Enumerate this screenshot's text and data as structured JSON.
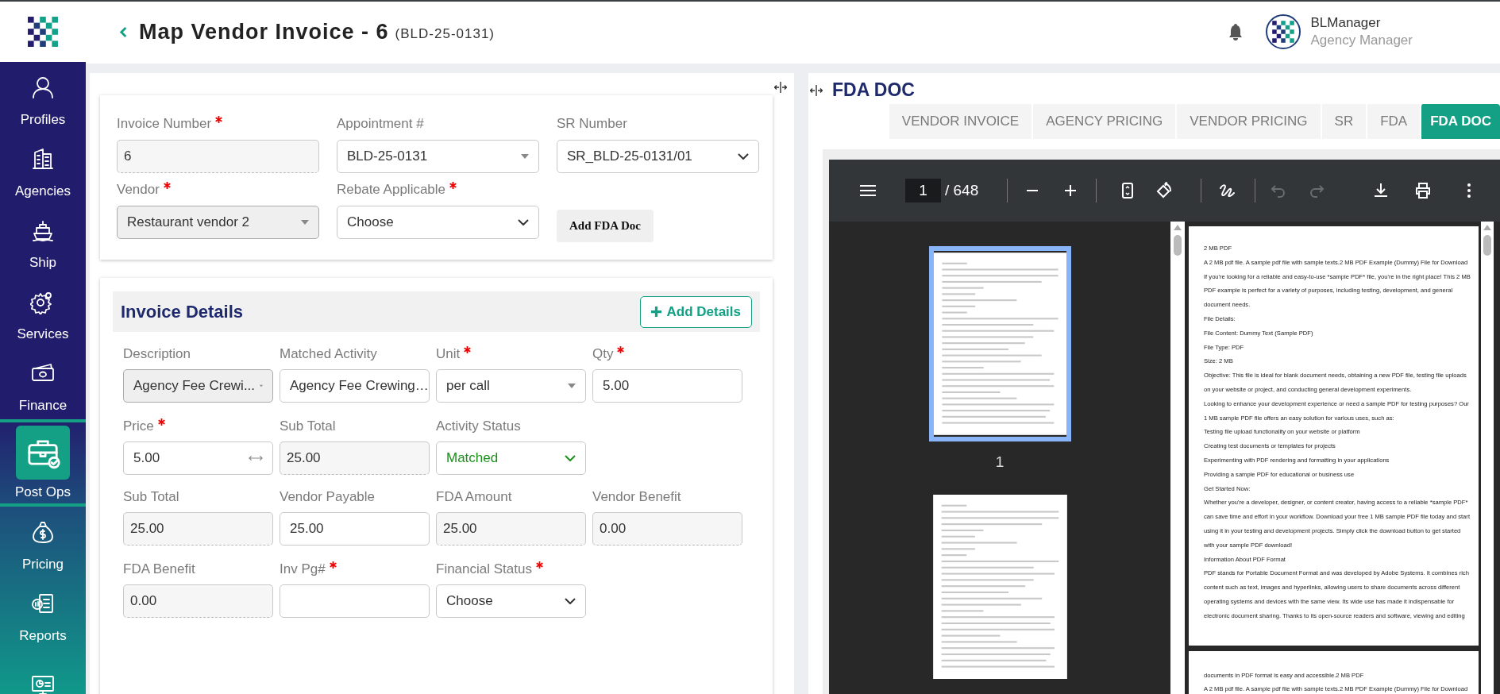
{
  "header": {
    "title": "Map Vendor Invoice - 6",
    "subtitle": "(BLD-25-0131)",
    "user": {
      "name": "BLManager",
      "role": "Agency Manager"
    }
  },
  "sidebar": {
    "items": [
      {
        "label": "Profiles",
        "selected": false
      },
      {
        "label": "Agencies",
        "selected": false
      },
      {
        "label": "Ship",
        "selected": false
      },
      {
        "label": "Services",
        "selected": false
      },
      {
        "label": "Finance",
        "selected": false
      },
      {
        "label": "Post Ops",
        "selected": true
      },
      {
        "label": "Pricing",
        "selected": false
      },
      {
        "label": "Reports",
        "selected": false
      }
    ]
  },
  "invoice_form": {
    "fields": [
      {
        "label": "Invoice Number",
        "required": true,
        "kind": "readonly",
        "value": "6"
      },
      {
        "label": "Appointment #",
        "required": false,
        "kind": "select",
        "value": "BLD-25-0131"
      },
      {
        "label": "SR Number",
        "required": false,
        "kind": "dropdown",
        "value": "SR_BLD-25-0131/01"
      },
      {
        "label": "Vendor",
        "required": true,
        "kind": "select-disabled",
        "value": "Restaurant vendor 2"
      },
      {
        "label": "Rebate Applicable",
        "required": true,
        "kind": "dropdown",
        "value": "Choose"
      }
    ],
    "add_fda_doc_button": "Add FDA Doc"
  },
  "invoice_details": {
    "title": "Invoice Details",
    "add_button": "Add Details",
    "sections": [
      {
        "fields": [
          {
            "label": "Description",
            "required": false,
            "kind": "select-disabled",
            "value": "Agency Fee Crewi..."
          },
          {
            "label": "Matched Activity",
            "required": false,
            "kind": "select",
            "value": "Agency Fee Crewing…"
          },
          {
            "label": "Unit",
            "required": true,
            "kind": "select",
            "value": "per call"
          },
          {
            "label": "Qty",
            "required": true,
            "kind": "input",
            "value": "5.00"
          },
          {
            "label": "Price",
            "required": true,
            "kind": "input",
            "resize_handle": true,
            "value": "5.00"
          },
          {
            "label": "Sub Total",
            "required": false,
            "kind": "readonly",
            "value": "25.00"
          },
          {
            "label": "Activity Status",
            "required": false,
            "kind": "status",
            "value": "Matched"
          }
        ]
      },
      {
        "fields": [
          {
            "label": "Sub Total",
            "required": false,
            "kind": "readonly",
            "value": "25.00"
          },
          {
            "label": "Vendor Payable",
            "required": false,
            "kind": "input",
            "value": "25.00"
          },
          {
            "label": "FDA Amount",
            "required": false,
            "kind": "readonly",
            "value": "25.00"
          },
          {
            "label": "Vendor Benefit",
            "required": false,
            "kind": "readonly",
            "value": "0.00"
          },
          {
            "label": "FDA Benefit",
            "required": false,
            "kind": "readonly",
            "value": "0.00"
          },
          {
            "label": "Inv Pg#",
            "required": true,
            "kind": "input"
          },
          {
            "label": "Financial Status",
            "required": true,
            "kind": "dropdown",
            "value": "Choose"
          }
        ]
      }
    ]
  },
  "doc_panel": {
    "title": "FDA DOC",
    "tabs": [
      {
        "label": "VENDOR INVOICE",
        "selected": false
      },
      {
        "label": "AGENCY PRICING",
        "selected": false
      },
      {
        "label": "VENDOR PRICING",
        "selected": false
      },
      {
        "label": "SR",
        "selected": false
      },
      {
        "label": "FDA",
        "selected": false
      },
      {
        "label": "FDA DOC",
        "selected": true
      }
    ],
    "viewer": {
      "page": "1",
      "total": "/ 648",
      "history_disabled": true,
      "thumbnails": [
        {
          "label": "1",
          "selected": true
        },
        {
          "selected": false
        }
      ],
      "pages": [
        {
          "lines": [
            "2 MB PDF",
            "A 2 MB pdf file. A sample pdf file with sample texts.2 MB PDF Example (Dummy) File for Download",
            "If you're looking for a reliable and easy-to-use *sample PDF* file, you're in the right place! This 2 MB",
            "PDF example is perfect for a variety of purposes, including testing, development, and general",
            "document needs.",
            "File Details:",
            "File Content: Dummy Text (Sample PDF)",
            "File Type: PDF",
            "Size: 2 MB",
            "Objective: This file is ideal for blank document needs, obtaining a new PDF file, testing file uploads",
            "on your website or project, and conducting general development experiments.",
            "Looking to enhance your development experience or need a sample PDF for testing purposes? Our",
            "1 MB sample PDF file offers an easy solution for various uses, such as:",
            "Testing file upload functionality on your website or platform",
            "Creating test documents or templates for projects",
            "Experimenting with PDF rendering and formatting in your applications",
            "Providing a sample PDF for educational or business use",
            "Get Started Now:",
            "Whether you're a developer, designer, or content creator, having access to a reliable *sample PDF*",
            "can save time and effort in your workflow. Download your free 1 MB sample PDF file today and start",
            "using it in your testing and development projects. Simply click the download button to get started",
            "with your sample PDF download!",
            "Information About PDF Format",
            "PDF stands for Portable Document Format and was developed by Adobe Systems. It combines rich",
            "content such as text, images and hyperlinks, allowing users to share documents across different",
            "operating systems and devices with the same view. Its wide use has made it indispensable for",
            "electronic document sharing. Thanks to its open-source readers and software, viewing and editing"
          ]
        },
        {
          "lines": [
            "documents in PDF format is easy and accessible.2 MB PDF",
            "A 2 MB pdf file. A sample pdf file with sample texts.2 MB PDF Example (Dummy) File for Download"
          ]
        }
      ]
    }
  }
}
